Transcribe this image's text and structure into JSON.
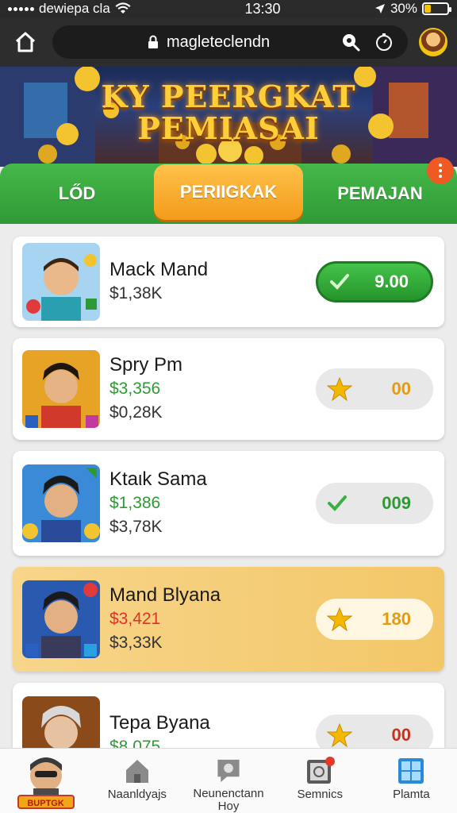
{
  "status_bar": {
    "carrier": "dewiepa cla",
    "time": "13:30",
    "battery": "30%",
    "battery_level": 0.3
  },
  "browser": {
    "url": "magleteclendn"
  },
  "banner": {
    "title_line1": "KY PEERGKAT",
    "title_line2": "PEMIASAI"
  },
  "tabs": [
    {
      "label": "LŐD",
      "active": false
    },
    {
      "label": "PERIIGKAK",
      "active": true
    },
    {
      "label": "PEMAJAN",
      "active": false
    }
  ],
  "players": [
    {
      "name": "Mack Mand",
      "line1": "",
      "line2": "$1,38K",
      "action": "9.00",
      "action_style": "green-btn",
      "icon": "check-icon"
    },
    {
      "name": "Spry Pm",
      "line1": "$3,356",
      "line1_color": "green",
      "line2": "$0,28K",
      "action": "00",
      "action_style": "gray",
      "icon": "star-icon"
    },
    {
      "name": "Ktaιk Sama",
      "line1": "$1,386",
      "line1_color": "green",
      "line2": "$3,78K",
      "action": "009",
      "action_style": "gray",
      "icon": "check-icon"
    },
    {
      "name": "Mand Blyana",
      "line1": "$3,421",
      "line1_color": "red",
      "line2": "$3,33K",
      "action": "180",
      "action_style": "light",
      "icon": "star-icon",
      "highlight": true
    },
    {
      "name": "Tepa Byana",
      "line1": "$8,075",
      "line1_color": "green",
      "line2": "",
      "action": "00",
      "action_style": "gray",
      "icon": "star-icon"
    }
  ],
  "bottom_nav": {
    "logo_label": "BUPTGK",
    "items": [
      {
        "label": "Naanldyajs"
      },
      {
        "label": "Neunenctann\nHoy"
      },
      {
        "label": "Semnics"
      },
      {
        "label": "Plamta"
      }
    ]
  },
  "colors": {
    "tab_green": "#3aa83f",
    "tab_active": "#f7a826",
    "highlight_row": "#f5cf7a"
  }
}
